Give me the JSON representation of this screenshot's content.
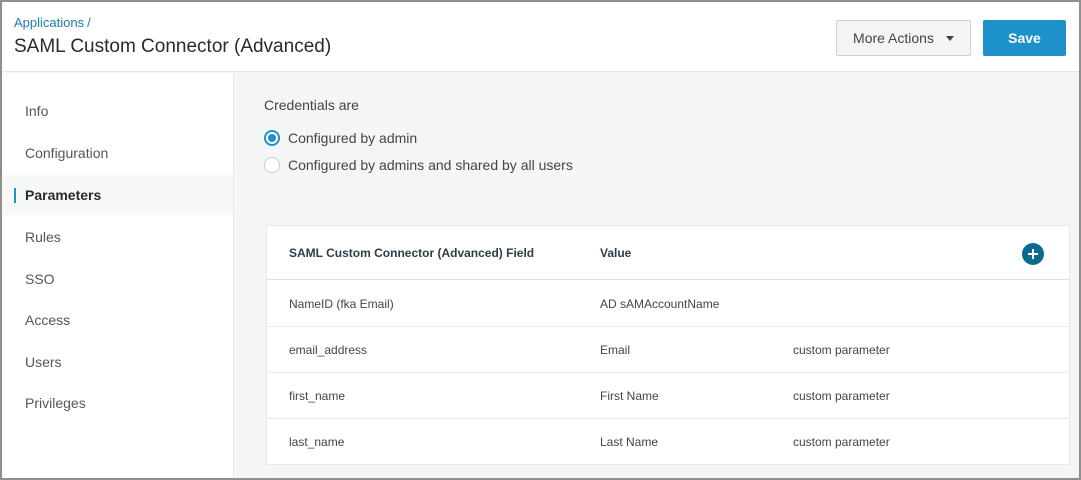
{
  "header": {
    "breadcrumb": "Applications",
    "breadcrumb_sep": "/",
    "title": "SAML Custom Connector (Advanced)",
    "more_actions_label": "More Actions",
    "save_label": "Save"
  },
  "sidebar": {
    "items": [
      {
        "label": "Info"
      },
      {
        "label": "Configuration"
      },
      {
        "label": "Parameters",
        "active": true
      },
      {
        "label": "Rules"
      },
      {
        "label": "SSO"
      },
      {
        "label": "Access"
      },
      {
        "label": "Users"
      },
      {
        "label": "Privileges"
      }
    ]
  },
  "credentials": {
    "label": "Credentials are",
    "options": [
      {
        "label": "Configured by admin",
        "checked": true
      },
      {
        "label": "Configured by admins and shared by all users",
        "checked": false
      }
    ]
  },
  "table": {
    "columns": [
      "SAML Custom Connector (Advanced) Field",
      "Value"
    ],
    "rows": [
      {
        "field": "NameID (fka Email)",
        "value": "AD sAMAccountName",
        "note": ""
      },
      {
        "field": "email_address",
        "value": "Email",
        "note": "custom parameter"
      },
      {
        "field": "first_name",
        "value": "First Name",
        "note": "custom parameter"
      },
      {
        "field": "last_name",
        "value": "Last Name",
        "note": "custom parameter"
      }
    ]
  },
  "icons": {
    "add": "plus-circle-icon",
    "dropdown": "caret-down-icon"
  },
  "colors": {
    "accent": "#1d91c9",
    "add_button": "#0d6a8f",
    "link": "#1a7db5"
  }
}
